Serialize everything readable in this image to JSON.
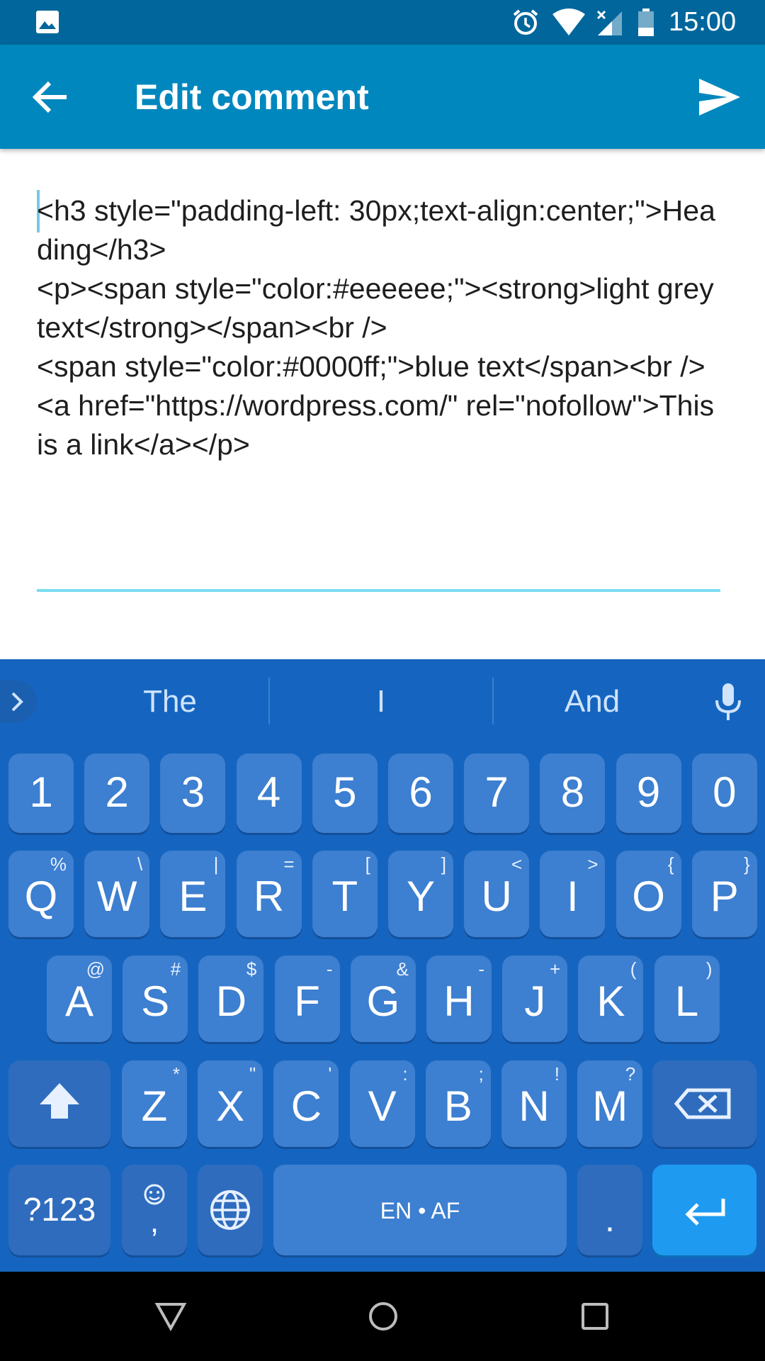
{
  "status_bar": {
    "time": "15:00"
  },
  "app_bar": {
    "title": "Edit comment"
  },
  "editor": {
    "content": "<h3 style=\"padding-left: 30px;text-align:center;\">Heading</h3>\n<p><span style=\"color:#eeeeee;\"><strong>light grey text</strong></span><br />\n<span style=\"color:#0000ff;\">blue text</span><br />\n<a href=\"https://wordpress.com/\" rel=\"nofollow\">This is a link</a></p>"
  },
  "keyboard": {
    "suggestions": [
      "The",
      "I",
      "And"
    ],
    "number_row": [
      "1",
      "2",
      "3",
      "4",
      "5",
      "6",
      "7",
      "8",
      "9",
      "0"
    ],
    "row1": [
      {
        "key": "Q",
        "hint": "%"
      },
      {
        "key": "W",
        "hint": "\\"
      },
      {
        "key": "E",
        "hint": "|"
      },
      {
        "key": "R",
        "hint": "="
      },
      {
        "key": "T",
        "hint": "["
      },
      {
        "key": "Y",
        "hint": "]"
      },
      {
        "key": "U",
        "hint": "<"
      },
      {
        "key": "I",
        "hint": ">"
      },
      {
        "key": "O",
        "hint": "{"
      },
      {
        "key": "P",
        "hint": "}"
      }
    ],
    "row2": [
      {
        "key": "A",
        "hint": "@"
      },
      {
        "key": "S",
        "hint": "#"
      },
      {
        "key": "D",
        "hint": "$"
      },
      {
        "key": "F",
        "hint": "-"
      },
      {
        "key": "G",
        "hint": "&"
      },
      {
        "key": "H",
        "hint": "-"
      },
      {
        "key": "J",
        "hint": "+"
      },
      {
        "key": "K",
        "hint": "("
      },
      {
        "key": "L",
        "hint": ")"
      }
    ],
    "row3": [
      {
        "key": "Z",
        "hint": "*"
      },
      {
        "key": "X",
        "hint": "\""
      },
      {
        "key": "C",
        "hint": "'"
      },
      {
        "key": "V",
        "hint": ":"
      },
      {
        "key": "B",
        "hint": ";"
      },
      {
        "key": "N",
        "hint": "!"
      },
      {
        "key": "M",
        "hint": "?"
      }
    ],
    "symbols_label": "?123",
    "comma_label": ",",
    "space_label": "EN • AF",
    "period_label": "."
  }
}
